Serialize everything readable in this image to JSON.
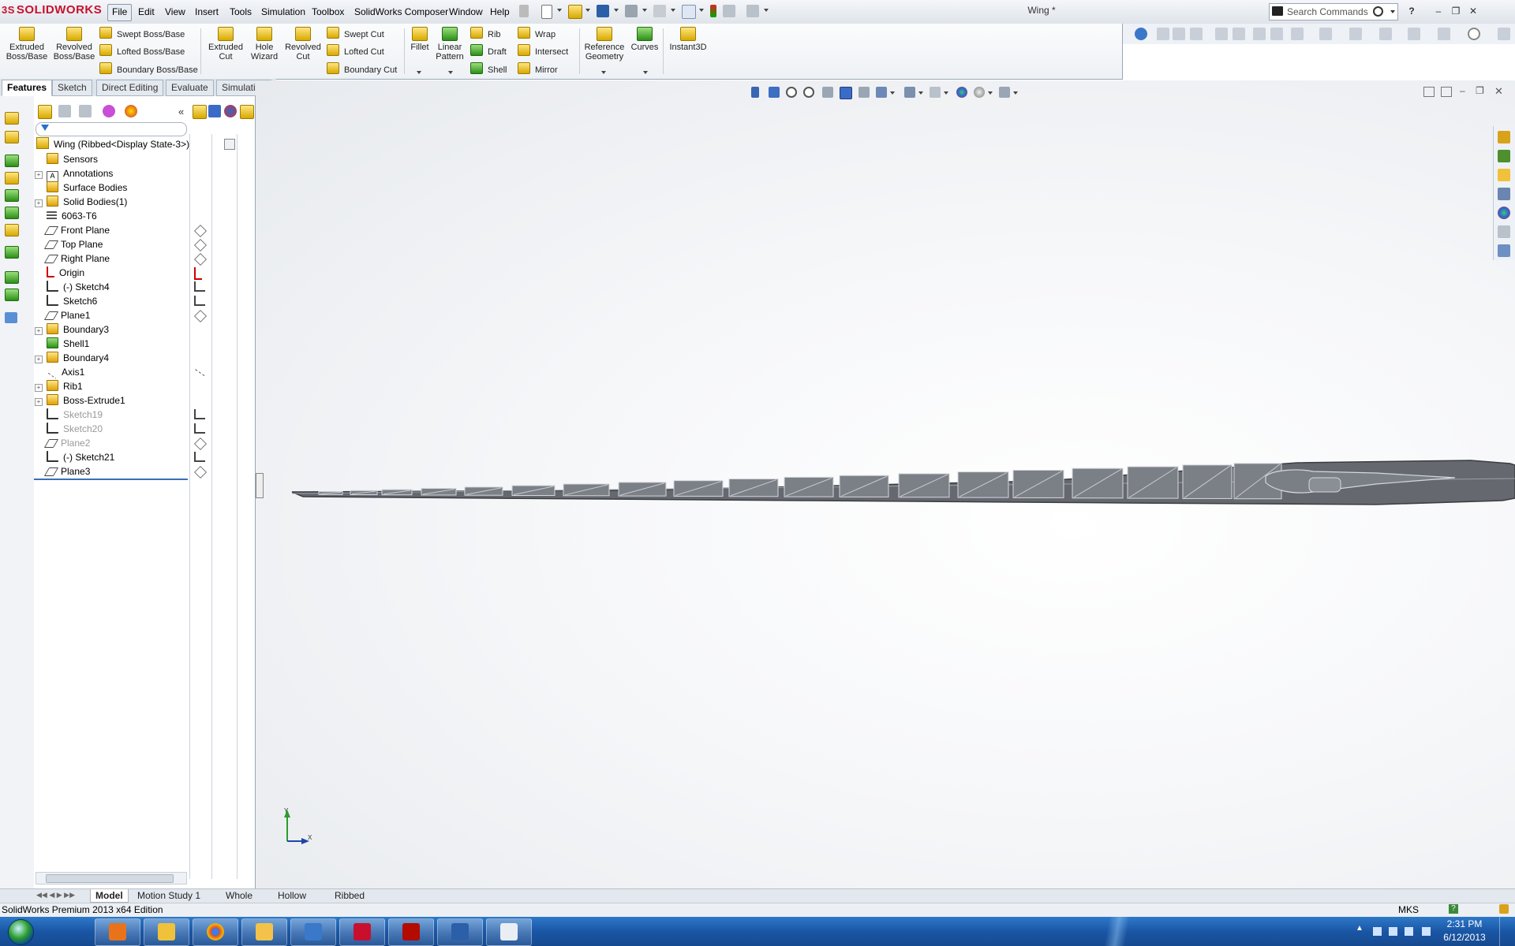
{
  "app": {
    "logo_text": "SOLIDWORKS",
    "document_title": "Wing *",
    "search_placeholder": "Search Commands"
  },
  "menu": [
    "File",
    "Edit",
    "View",
    "Insert",
    "Tools",
    "Simulation",
    "Toolbox",
    "SolidWorks Composer",
    "Window",
    "Help"
  ],
  "command_manager": {
    "extruded_boss": "Extruded Boss/Base",
    "revolved_boss": "Revolved Boss/Base",
    "swept_boss": "Swept Boss/Base",
    "lofted_boss": "Lofted Boss/Base",
    "boundary_boss": "Boundary Boss/Base",
    "extruded_cut": "Extruded Cut",
    "hole_wizard": "Hole Wizard",
    "revolved_cut": "Revolved Cut",
    "swept_cut": "Swept Cut",
    "lofted_cut": "Lofted Cut",
    "boundary_cut": "Boundary Cut",
    "fillet": "Fillet",
    "linear_pattern": "Linear Pattern",
    "rib": "Rib",
    "draft": "Draft",
    "shell": "Shell",
    "wrap": "Wrap",
    "intersect": "Intersect",
    "mirror": "Mirror",
    "reference_geometry": "Reference Geometry",
    "curves": "Curves",
    "instant3d": "Instant3D"
  },
  "tabs": [
    "Features",
    "Sketch",
    "Direct Editing",
    "Evaluate",
    "Simulation"
  ],
  "feature_tree": {
    "root": "Wing  (Ribbed<Display State-3>)",
    "items": [
      {
        "label": "Sensors",
        "icon": "sensor-icon",
        "expandable": false,
        "dim": false,
        "right": ""
      },
      {
        "label": "Annotations",
        "icon": "annotations-icon",
        "expandable": true,
        "dim": false,
        "right": ""
      },
      {
        "label": "Surface Bodies",
        "icon": "surface-bodies-icon",
        "expandable": false,
        "dim": false,
        "right": ""
      },
      {
        "label": "Solid Bodies(1)",
        "icon": "solid-bodies-icon",
        "expandable": true,
        "dim": false,
        "right": ""
      },
      {
        "label": "6063-T6",
        "icon": "material-icon",
        "expandable": false,
        "dim": false,
        "right": ""
      },
      {
        "label": "Front Plane",
        "icon": "plane-icon",
        "expandable": false,
        "dim": false,
        "right": "plane"
      },
      {
        "label": "Top Plane",
        "icon": "plane-icon",
        "expandable": false,
        "dim": false,
        "right": "plane"
      },
      {
        "label": "Right Plane",
        "icon": "plane-icon",
        "expandable": false,
        "dim": false,
        "right": "plane"
      },
      {
        "label": "Origin",
        "icon": "origin-icon",
        "expandable": false,
        "dim": false,
        "right": "origin"
      },
      {
        "label": "(-) Sketch4",
        "icon": "sketch-icon",
        "expandable": false,
        "dim": false,
        "right": "sketch"
      },
      {
        "label": "Sketch6",
        "icon": "sketch-icon",
        "expandable": false,
        "dim": false,
        "right": "sketch"
      },
      {
        "label": "Plane1",
        "icon": "plane-icon",
        "expandable": false,
        "dim": false,
        "right": "plane"
      },
      {
        "label": "Boundary3",
        "icon": "boundary-icon",
        "expandable": true,
        "dim": false,
        "right": ""
      },
      {
        "label": "Shell1",
        "icon": "shell-icon",
        "expandable": false,
        "dim": false,
        "right": ""
      },
      {
        "label": "Boundary4",
        "icon": "boundary-icon",
        "expandable": true,
        "dim": false,
        "right": ""
      },
      {
        "label": "Axis1",
        "icon": "axis-icon",
        "expandable": false,
        "dim": false,
        "right": "axis"
      },
      {
        "label": "Rib1",
        "icon": "rib-icon",
        "expandable": true,
        "dim": false,
        "right": ""
      },
      {
        "label": "Boss-Extrude1",
        "icon": "extrude-icon",
        "expandable": true,
        "dim": false,
        "right": ""
      },
      {
        "label": "Sketch19",
        "icon": "sketch-icon",
        "expandable": false,
        "dim": true,
        "right": "sketch"
      },
      {
        "label": "Sketch20",
        "icon": "sketch-icon",
        "expandable": false,
        "dim": true,
        "right": "sketch"
      },
      {
        "label": "Plane2",
        "icon": "plane-icon",
        "expandable": false,
        "dim": true,
        "right": "plane"
      },
      {
        "label": "(-) Sketch21",
        "icon": "sketch-icon",
        "expandable": false,
        "dim": false,
        "right": "sketch"
      },
      {
        "label": "Plane3",
        "icon": "plane-icon",
        "expandable": false,
        "dim": false,
        "right": "plane"
      }
    ]
  },
  "model_tabs": [
    "Model",
    "Motion Study 1",
    "Whole",
    "Hollow",
    "Ribbed"
  ],
  "status": {
    "edition": "SolidWorks Premium 2013 x64 Edition",
    "units": "MKS"
  },
  "taskbar": {
    "apps": [
      "windows-explorer",
      "media-player",
      "file-explorer",
      "chrome",
      "outlook",
      "teamviewer",
      "solidworks",
      "acrobat",
      "word",
      "paint"
    ],
    "time": "2:31 PM",
    "date": "6/12/2013"
  },
  "colors": {
    "brand_red": "#c8102e",
    "taskbar_blue": "#1a56a5",
    "model_gray": "#6e737a"
  }
}
